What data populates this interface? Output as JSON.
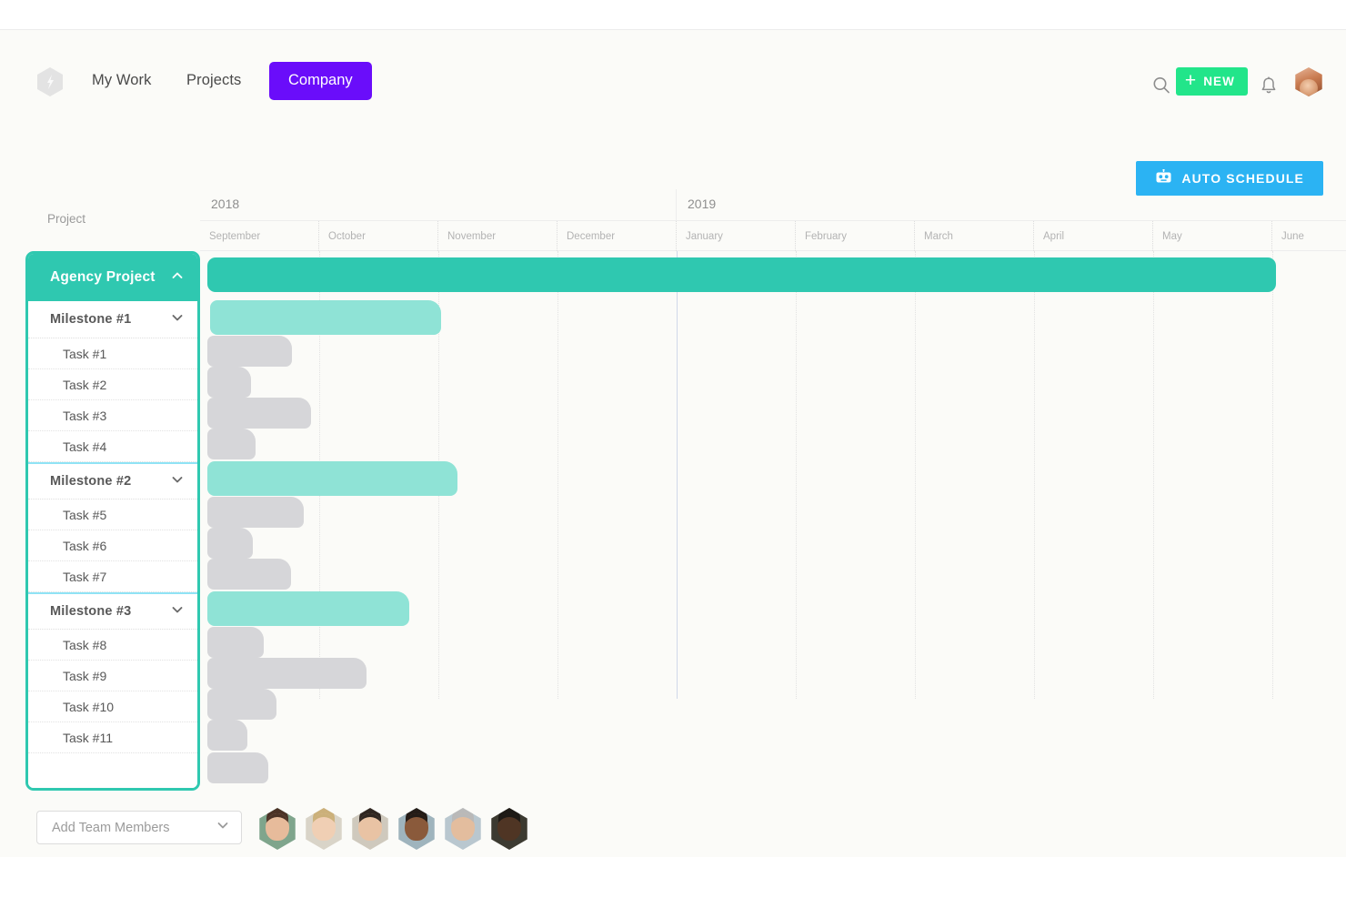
{
  "window": {
    "dot": "window-dot"
  },
  "header": {
    "logo": "app-logo",
    "nav": [
      {
        "id": "my-work",
        "label": "My Work",
        "active": false
      },
      {
        "id": "projects",
        "label": "Projects",
        "active": false
      },
      {
        "id": "company",
        "label": "Company",
        "active": true
      }
    ],
    "search_icon": "search-icon",
    "new_button": {
      "label": "NEW",
      "icon": "plus-icon",
      "color": "#22E58A"
    },
    "bell_icon": "bell-icon",
    "avatar": "user-avatar",
    "auto_schedule": {
      "label": "AUTO SCHEDULE",
      "icon": "robot-icon",
      "color": "#2BB3F3"
    }
  },
  "gantt": {
    "column_header": "Project",
    "years": [
      {
        "label": "2018",
        "months": 4
      },
      {
        "label": "2019",
        "months": 6
      }
    ],
    "months": [
      "September",
      "October",
      "November",
      "December",
      "January",
      "February",
      "March",
      "April",
      "May",
      "June"
    ],
    "month_width": 131,
    "rows": [
      {
        "type": "project",
        "label": "Agency Project",
        "chevron": "chevron-up-icon",
        "bar": {
          "start": 8,
          "end": 1183,
          "color": "#2FC8B0"
        }
      },
      {
        "type": "milestone",
        "label": "Milestone #1",
        "chevron": "chevron-down-icon",
        "bar": {
          "start": 11,
          "end": 265,
          "color": "#8FE3D6"
        }
      },
      {
        "type": "task",
        "label": "Task #1",
        "bar": {
          "start": 8,
          "end": 101,
          "color": "#D6D6D9"
        }
      },
      {
        "type": "task",
        "label": "Task #2",
        "bar": {
          "start": 8,
          "end": 56,
          "color": "#D6D6D9"
        }
      },
      {
        "type": "task",
        "label": "Task #3",
        "bar": {
          "start": 8,
          "end": 122,
          "color": "#D6D6D9"
        }
      },
      {
        "type": "task",
        "label": "Task #4",
        "bar": {
          "start": 8,
          "end": 61,
          "color": "#D6D6D9"
        }
      },
      {
        "type": "milestone",
        "label": "Milestone #2",
        "chevron": "chevron-down-icon",
        "bar": {
          "start": 8,
          "end": 283,
          "color": "#8FE3D6"
        }
      },
      {
        "type": "task",
        "label": "Task #5",
        "bar": {
          "start": 8,
          "end": 114,
          "color": "#D6D6D9"
        }
      },
      {
        "type": "task",
        "label": "Task #6",
        "bar": {
          "start": 8,
          "end": 58,
          "color": "#D6D6D9"
        }
      },
      {
        "type": "task",
        "label": "Task #7",
        "bar": {
          "start": 8,
          "end": 100,
          "color": "#D6D6D9"
        }
      },
      {
        "type": "milestone",
        "label": "Milestone #3",
        "chevron": "chevron-down-icon",
        "bar": {
          "start": 8,
          "end": 230,
          "color": "#8FE3D6"
        }
      },
      {
        "type": "task",
        "label": "Task #8",
        "bar": {
          "start": 8,
          "end": 70,
          "color": "#D6D6D9"
        }
      },
      {
        "type": "task",
        "label": "Task #9",
        "bar": {
          "start": 8,
          "end": 183,
          "color": "#D6D6D9"
        }
      },
      {
        "type": "task",
        "label": "Task #10",
        "bar": {
          "start": 8,
          "end": 84,
          "color": "#D6D6D9"
        }
      },
      {
        "type": "task",
        "label": "Task #11",
        "bar": {
          "start": 8,
          "end": 52,
          "color": "#D6D6D9"
        }
      },
      {
        "type": "empty",
        "label": "",
        "bar": {
          "start": 8,
          "end": 75,
          "color": "#D6D6D9"
        }
      }
    ]
  },
  "footer": {
    "add_team": {
      "placeholder": "Add Team Members",
      "chevron": "chevron-down-icon"
    },
    "team": [
      {
        "name": "team-member-1",
        "hair": "#4b3226",
        "skin": "#e7bb9b",
        "bg": "#7fa58c"
      },
      {
        "name": "team-member-2",
        "hair": "#cbb07a",
        "skin": "#f0cfb4",
        "bg": "#d9d4c8"
      },
      {
        "name": "team-member-3",
        "hair": "#2f2621",
        "skin": "#e9c3a4",
        "bg": "#cfc9bd"
      },
      {
        "name": "team-member-4",
        "hair": "#241c17",
        "skin": "#8a5a3b",
        "bg": "#9fb4bd"
      },
      {
        "name": "team-member-5",
        "hair": "#b9b9b9",
        "skin": "#e3bd9e",
        "bg": "#b9c7cf"
      },
      {
        "name": "team-member-6",
        "hair": "#1d1a16",
        "skin": "#4f3524",
        "bg": "#3c3a31"
      }
    ]
  }
}
